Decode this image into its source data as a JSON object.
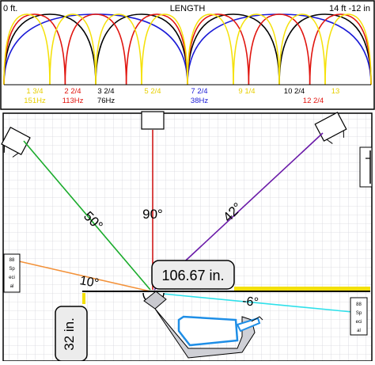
{
  "top": {
    "left_label": "0 ft.",
    "title": "LENGTH",
    "right_label": "14 ft -12 in",
    "modes": [
      {
        "position": "1 3/4",
        "freq": "151Hz",
        "color": "#f5e10a"
      },
      {
        "position": "2 2/4",
        "freq": "113Hz",
        "color": "#e0140e"
      },
      {
        "position": "3 2/4",
        "freq": "76Hz",
        "color": "#000000"
      },
      {
        "position": "5 2/4",
        "freq": "",
        "color": "#f5e10a"
      },
      {
        "position": "7 2/4",
        "freq": "38Hz",
        "color": "#1a1ad6"
      },
      {
        "position": "9 1/4",
        "freq": "",
        "color": "#f5e10a"
      },
      {
        "position": "10 2/4",
        "freq": "",
        "color": "#000000"
      },
      {
        "position": "",
        "freq": "12 2/4",
        "color": "#e0140e"
      },
      {
        "position": "13",
        "freq": "",
        "color": "#f5e10a"
      }
    ]
  },
  "plan": {
    "angles": {
      "a90": "90°",
      "a50": "50°",
      "a42": "42°",
      "a10": "10°",
      "aneg6": "-6°"
    },
    "distance_label": "106.67 in.",
    "height_label": "32 in.",
    "left_box": [
      "88",
      "Sp",
      "eci",
      "al"
    ],
    "right_box": [
      "88",
      "Sp",
      "eci",
      "al"
    ],
    "colors": {
      "green": "#1aab2b",
      "red": "#d01a1a",
      "purple": "#6a1aa8",
      "orange": "#f3923a",
      "cyan": "#2ee0ea",
      "yellow": "#f3e00a",
      "blue": "#1e8ee6"
    }
  }
}
